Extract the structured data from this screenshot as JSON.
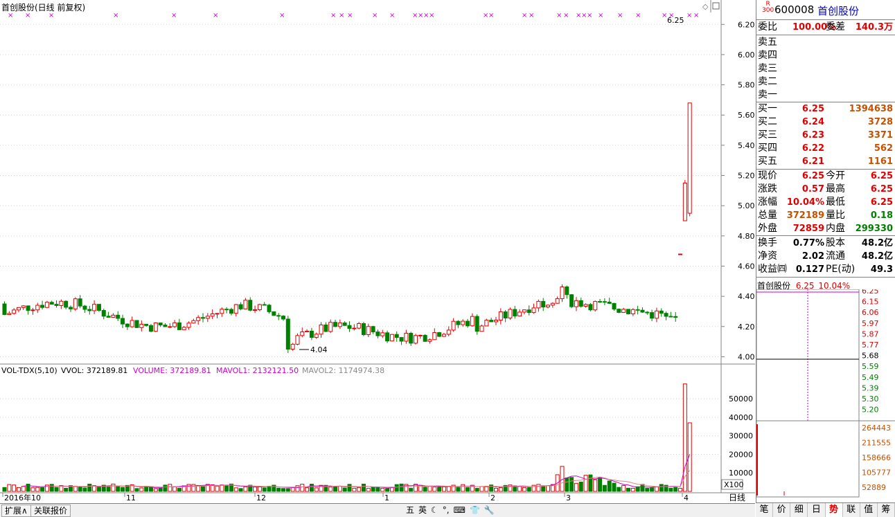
{
  "window": {
    "title": "首创股份(日线 前复权)",
    "last_price_marker": "6.25",
    "min_marker": "4.04"
  },
  "volume_header": {
    "name": "VOL-TDX(5,10)",
    "vvol": "VVOL: 372189.81",
    "volume": "VOLUME: 372189.81",
    "mavol1": "MAVOL1: 2132121.50",
    "mavol2": "MAVOL2: 1174974.38",
    "multiplier": "X100"
  },
  "chart_data": {
    "type": "candlestick",
    "price_axis": {
      "ticks": [
        "6.20",
        "6.00",
        "5.80",
        "5.60",
        "5.40",
        "5.20",
        "5.00",
        "4.80",
        "4.60",
        "4.40",
        "4.20",
        "4.00"
      ],
      "range": [
        3.97,
        6.27
      ]
    },
    "volume_axis": {
      "ticks": [
        "50000",
        "40000",
        "30000",
        "20000",
        "10000"
      ],
      "range": [
        0,
        62000
      ]
    },
    "time_axis": [
      "2016年10",
      "11",
      "12",
      "1",
      "2",
      "3",
      "4"
    ],
    "period_label": "日线",
    "colors": {
      "up": "#e10000",
      "down": "#008000",
      "ma1": "#cc00cc",
      "ma2": "#e08080"
    }
  },
  "quote": {
    "code": "600008",
    "name": "首创股份",
    "badge_top": "R",
    "badge_bottom": "300",
    "weibi_label": "委比",
    "weibi": "100.00%",
    "weicha_label": "委差",
    "weicha": "140.3万",
    "sell": [
      {
        "label": "卖五"
      },
      {
        "label": "卖四"
      },
      {
        "label": "卖三"
      },
      {
        "label": "卖二"
      },
      {
        "label": "卖一"
      }
    ],
    "buy": [
      {
        "label": "买一",
        "price": "6.25",
        "vol": "1394638"
      },
      {
        "label": "买二",
        "price": "6.24",
        "vol": "3728"
      },
      {
        "label": "买三",
        "price": "6.23",
        "vol": "3371"
      },
      {
        "label": "买四",
        "price": "6.22",
        "vol": "562"
      },
      {
        "label": "买五",
        "price": "6.21",
        "vol": "1161"
      }
    ],
    "stats": [
      {
        "l1": "现价",
        "v1": "6.25",
        "c1": "red",
        "l2": "今开",
        "v2": "6.25",
        "c2": "red"
      },
      {
        "l1": "涨跌",
        "v1": "0.57",
        "c1": "red",
        "l2": "最高",
        "v2": "6.25",
        "c2": "red"
      },
      {
        "l1": "涨幅",
        "v1": "10.04%",
        "c1": "red",
        "l2": "最低",
        "v2": "6.25",
        "c2": "red"
      },
      {
        "l1": "总量",
        "v1": "372189",
        "c1": "orange",
        "l2": "量比",
        "v2": "0.18",
        "c2": "green"
      },
      {
        "l1": "外盘",
        "v1": "72859",
        "c1": "red",
        "l2": "内盘",
        "v2": "299330",
        "c2": "green"
      }
    ],
    "fin": [
      {
        "l1": "换手",
        "v1": "0.77%",
        "l2": "股本",
        "v2": "48.2亿"
      },
      {
        "l1": "净资",
        "v1": "2.02",
        "l2": "流通",
        "v2": "48.2亿"
      },
      {
        "l1": "收益㈣",
        "v1": "0.127",
        "l2": "PE(动)",
        "v2": "49.3"
      }
    ],
    "mini_name": "首创股份",
    "mini_price": "6.25",
    "mini_pct": "10.04%",
    "mini_price_ticks": [
      "6.25",
      "6.15",
      "6.06",
      "5.97",
      "5.87",
      "5.77",
      "5.68",
      "5.59",
      "5.49",
      "5.39",
      "5.30",
      "5.20"
    ],
    "mini_vol_ticks": [
      "264443",
      "211555",
      "158666",
      "105777",
      "52889"
    ]
  },
  "bottom": {
    "btn1": "扩展∧",
    "btn2": "关联报价",
    "ime": [
      "五",
      "英",
      "☾",
      "°,",
      "⌨",
      "👕",
      "🔧"
    ]
  },
  "tabs": [
    "笔",
    "价",
    "细",
    "日",
    "势",
    "联",
    "值",
    "筹"
  ]
}
